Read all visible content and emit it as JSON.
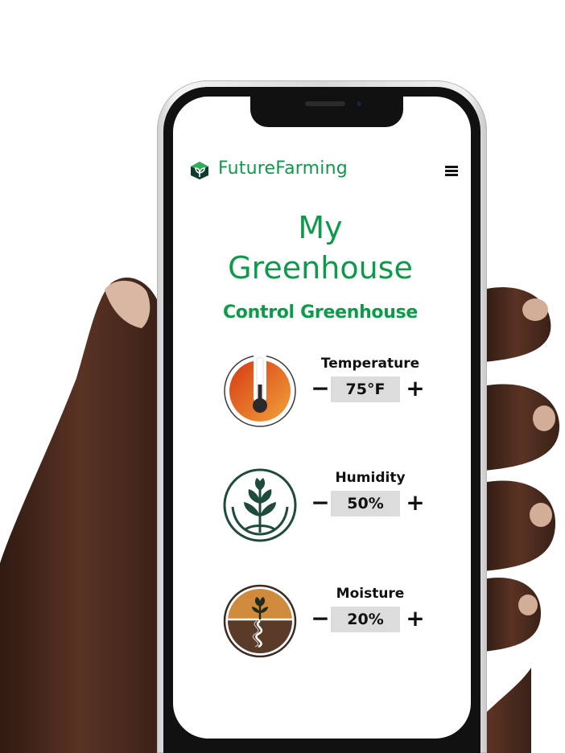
{
  "app": {
    "brand_name": "FutureFarming",
    "menu_icon": "hamburger-menu-icon"
  },
  "page": {
    "title_line1": "My",
    "title_line2": "Greenhouse",
    "section_title": "Control Greenhouse"
  },
  "controls": [
    {
      "label": "Temperature",
      "value": "75°F",
      "icon": "thermometer-icon",
      "minus": "−",
      "plus": "+"
    },
    {
      "label": "Humidity",
      "value": "50%",
      "icon": "plant-leaves-icon",
      "minus": "−",
      "plus": "+"
    },
    {
      "label": "Moisture",
      "value": "20%",
      "icon": "soil-sprout-icon",
      "minus": "−",
      "plus": "+"
    }
  ],
  "colors": {
    "brand_green": "#0d9a4a",
    "thermo_orange": "#e8621e",
    "leaf_dark_green": "#1e4b3a",
    "soil_brown": "#5a3a28",
    "soil_tan": "#d08a3c",
    "value_bg": "#dcdcdc"
  }
}
